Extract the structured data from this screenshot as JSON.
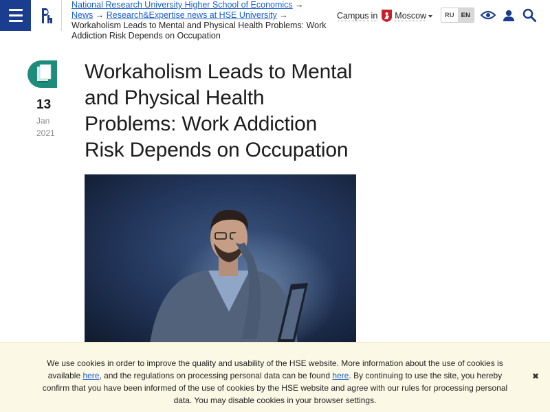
{
  "header": {
    "breadcrumb": {
      "link1": "National Research University Higher School of Economics",
      "sep1": " → ",
      "link2": "News",
      "sep2": " → ",
      "link3": "Research&Expertise news at HSE University",
      "sep3": " → ",
      "current": "Workaholism Leads to Mental and Physical Health Problems: Work Addiction Risk Depends on Occupation"
    },
    "campus": {
      "label": "Campus",
      "in": "in",
      "city": "Moscow"
    },
    "lang": {
      "ru": "RU",
      "en": "EN",
      "active": "EN"
    },
    "icons": [
      "menu-icon",
      "hse-logo",
      "eye-icon",
      "user-icon",
      "search-icon"
    ]
  },
  "article": {
    "date": {
      "day": "13",
      "month": "Jan",
      "year": "2021"
    },
    "title": "Workaholism Leads to Mental and Physical Health Problems: Work Addiction Risk Depends on Occupation",
    "icon": "book-icon",
    "accent_color": "#1e8c7a"
  },
  "cookie": {
    "text1": "We use cookies in order to improve the quality and usability of the HSE website. More information about the use of cookies is available ",
    "link1": "here",
    "text2": ", and the regulations on processing personal data can be found ",
    "link2": "here",
    "text3": ". By continuing to use the site, you hereby confirm that you have been informed of the use of cookies by the HSE website and agree with our rules for processing personal data. You may disable cookies in your browser settings.",
    "close": "✖"
  },
  "colors": {
    "brand": "#1a3d8f",
    "link": "#1a5fd0",
    "cookie_bg": "#fbf8e6"
  }
}
